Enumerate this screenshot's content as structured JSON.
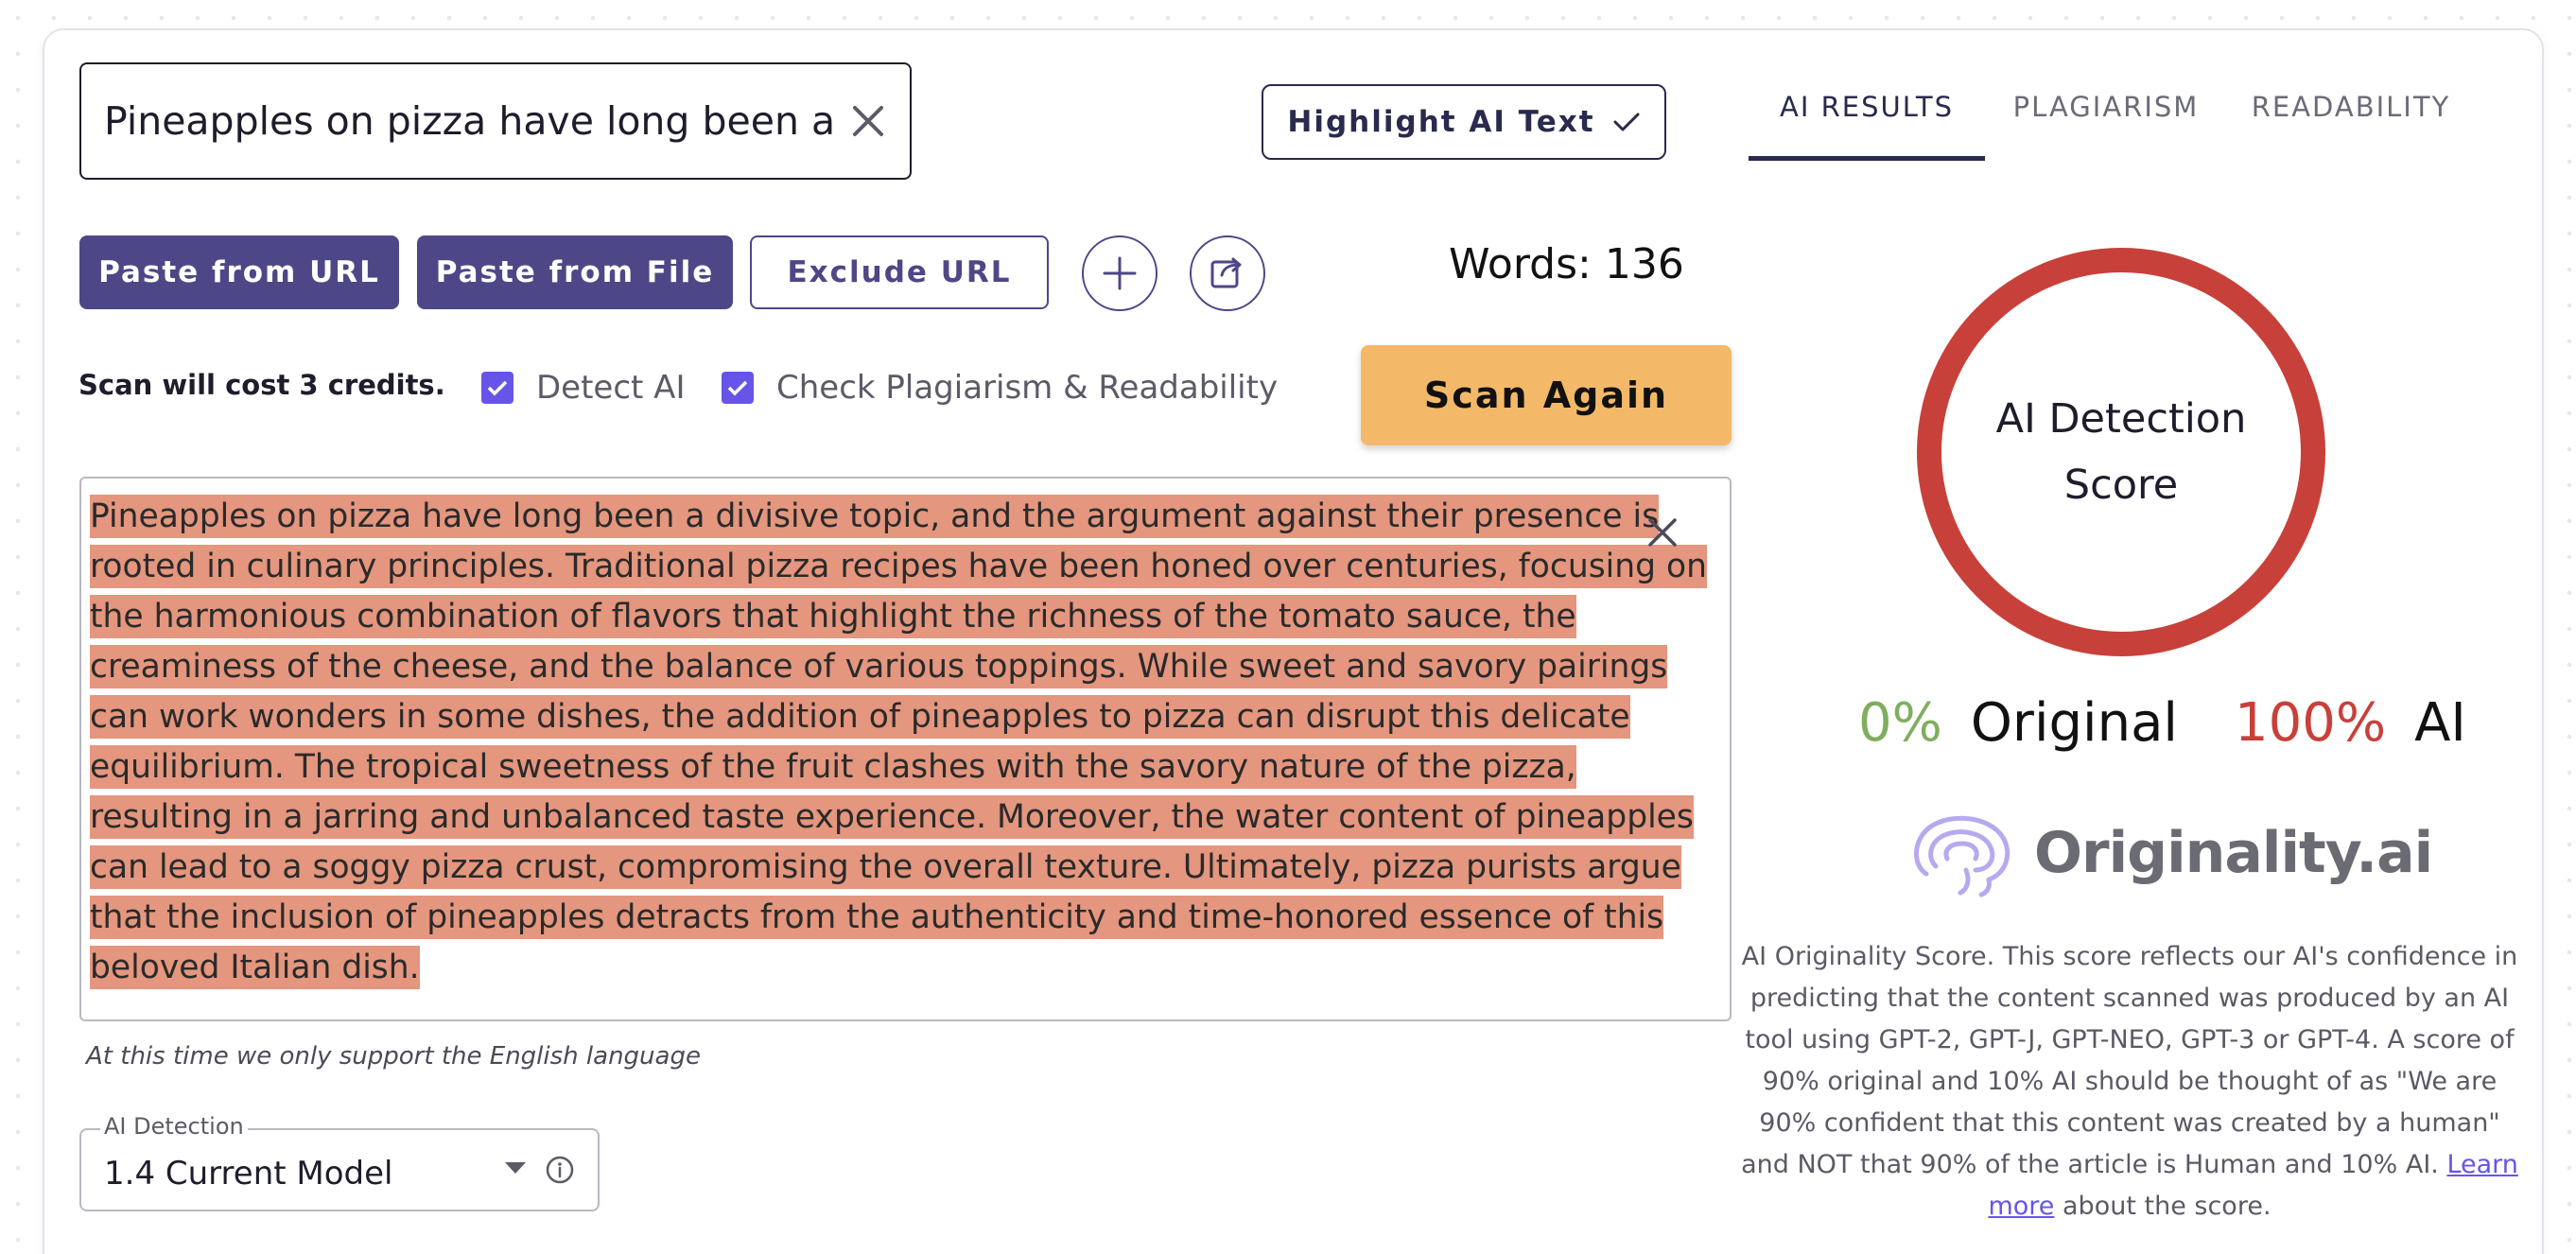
{
  "title_input": {
    "value": "Pineapples on pizza have long been a divisive topic"
  },
  "buttons": {
    "highlight_ai_text": "Highlight AI Text",
    "paste_from_url": "Paste from URL",
    "paste_from_file": "Paste from File",
    "exclude_url": "Exclude URL",
    "scan_again": "Scan Again"
  },
  "words_count": "Words: 136",
  "scan_cost": "Scan will cost 3 credits.",
  "options": {
    "detect_ai": {
      "label": "Detect AI",
      "checked": true
    },
    "check_plagiarism": {
      "label": "Check Plagiarism & Readability",
      "checked": true
    }
  },
  "editor": {
    "text": "Pineapples on pizza have long been a divisive topic, and the argument against their presence is rooted in culinary principles. Traditional pizza recipes have been honed over centuries, focusing on the harmonious combination of flavors that highlight the richness of the tomato sauce, the creaminess of the cheese, and the balance of various toppings. While sweet and savory pairings can work wonders in some dishes, the addition of pineapples to pizza can disrupt this delicate equilibrium. The tropical sweetness of the fruit clashes with the savory nature of the pizza, resulting in a jarring and unbalanced taste experience. Moreover, the water content of pineapples can lead to a soggy pizza crust, compromising the overall texture. Ultimately, pizza purists argue that the inclusion of pineapples detracts from the authenticity and time-honored essence of this beloved Italian dish.",
    "highlight_color": "#e4967e"
  },
  "language_note": "At this time we only support the English language",
  "model_select": {
    "legend": "AI Detection",
    "value": "1.4 Current Model"
  },
  "tabs": [
    {
      "label": "AI RESULTS",
      "active": true
    },
    {
      "label": "PLAGIARISM",
      "active": false
    },
    {
      "label": "READABILITY",
      "active": false
    }
  ],
  "score": {
    "ring_label": "AI Detection Score",
    "original_pct": "0%",
    "original_label": "Original",
    "ai_pct": "100%",
    "ai_label": "AI",
    "ai_fraction": 1.0
  },
  "brand": {
    "name": "Originality.ai"
  },
  "description": {
    "text": "AI Originality Score. This score reflects our AI's confidence in predicting that the content scanned was produced by an AI tool using GPT-2, GPT-J, GPT-NEO, GPT-3 or GPT-4. A score of 90% original and 10% AI should be thought of as \"We are 90% confident that this content was created by a human\" and NOT that 90% of the article is Human and 10% AI.",
    "link": "Learn more",
    "tail": "about the score."
  },
  "colors": {
    "primary": "#4e4787",
    "accent_yellow": "#f4b968",
    "ai_red": "#c8403a",
    "original_green": "#7fae5e",
    "checkbox": "#6655e8"
  },
  "icons": [
    "close-icon",
    "checkmark-icon",
    "plus-icon",
    "share-icon",
    "info-icon",
    "brain-logo-icon",
    "caret-down-icon"
  ]
}
